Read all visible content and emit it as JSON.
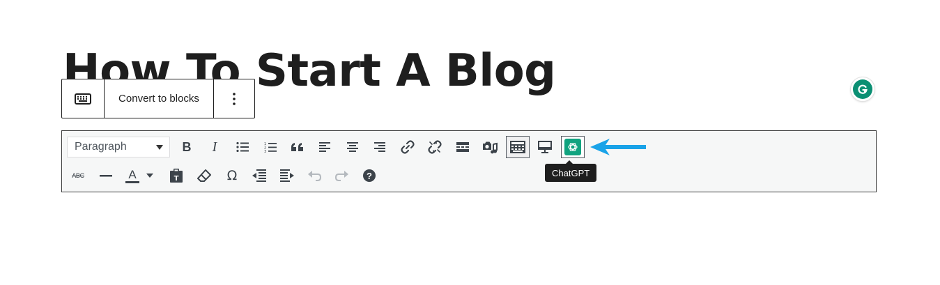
{
  "post": {
    "title": "How To Start A Blog"
  },
  "block_toolbar": {
    "keyboard_icon": "keyboard-icon",
    "convert_label": "Convert to blocks",
    "more_icon": "vertical-ellipsis-icon"
  },
  "grammarly": {
    "icon": "grammarly-g-icon",
    "color": "#0b8f73"
  },
  "editor_toolbar": {
    "format_select": {
      "value": "Paragraph"
    },
    "row1_icons": [
      "bold-icon",
      "italic-icon",
      "bullet-list-icon",
      "numbered-list-icon",
      "blockquote-icon",
      "align-left-icon",
      "align-center-icon",
      "align-right-icon",
      "link-icon",
      "unlink-icon",
      "read-more-icon",
      "add-media-icon",
      "toolbar-toggle-icon",
      "preview-icon",
      "chatgpt-icon"
    ],
    "row2_icons": [
      "strikethrough-icon",
      "horizontal-line-icon",
      "text-color-icon",
      "paste-as-text-icon",
      "clear-formatting-icon",
      "special-character-icon",
      "outdent-icon",
      "indent-icon",
      "undo-icon",
      "redo-icon",
      "help-icon"
    ],
    "bold_label": "B",
    "italic_label": "I",
    "text_color_label": "A",
    "strike_label": "ABC",
    "omega_label": "Ω",
    "help_label": "?",
    "chatgpt_color": "#10a37f",
    "tooltip": "ChatGPT"
  },
  "annotation": {
    "arrow_color": "#1aa3e8"
  }
}
